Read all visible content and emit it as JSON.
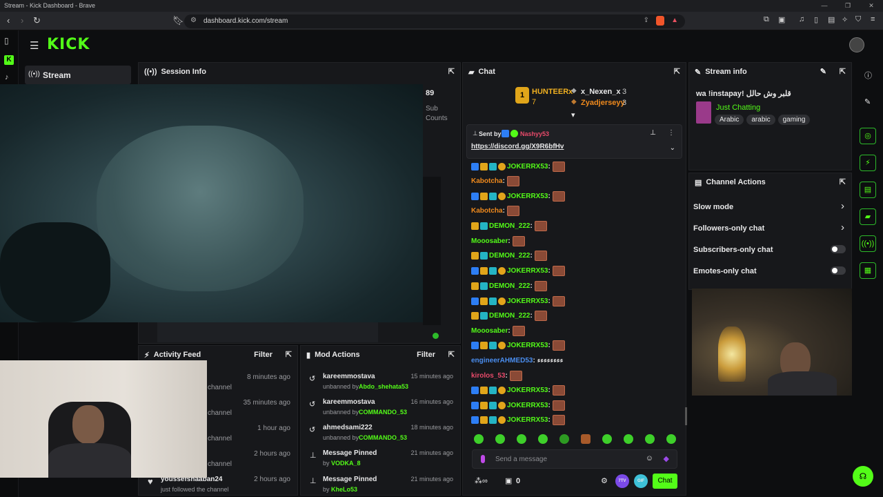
{
  "browser": {
    "window_title": "Stream - Kick Dashboard - Brave",
    "url": "dashboard.kick.com/stream"
  },
  "header": {
    "logo": "KICK"
  },
  "sidebar": {
    "stream_label": "Stream"
  },
  "session_info": {
    "title": "Session Info",
    "stat_value": "89",
    "stat_label_1": "Sub",
    "stat_label_2": "Counts"
  },
  "chat": {
    "title": "Chat",
    "leaderboard": {
      "rank1_name": "HUNTEERx",
      "rank1_count": "7",
      "rank2_name": "x_Nexen_x",
      "rank2_count": "3",
      "rank3_name": "Zyadjerseyy",
      "rank3_count": "3"
    },
    "pinned": {
      "sent_by": "Sent by",
      "user": "Nashyy53",
      "link": "https://discord.gg/X9R6bfHv"
    },
    "messages": [
      {
        "user": "JOKERRX53",
        "color": "green"
      },
      {
        "user": "Kabotcha",
        "color": "orange"
      },
      {
        "user": "JOKERRX53",
        "color": "green"
      },
      {
        "user": "Kabotcha",
        "color": "orange"
      },
      {
        "user": "DEMON_222",
        "color": "green"
      },
      {
        "user": "Mooosaber",
        "color": "green"
      },
      {
        "user": "DEMON_222",
        "color": "green"
      },
      {
        "user": "JOKERRX53",
        "color": "green"
      },
      {
        "user": "DEMON_222",
        "color": "green"
      },
      {
        "user": "JOKERRX53",
        "color": "green"
      },
      {
        "user": "DEMON_222",
        "color": "green"
      },
      {
        "user": "Mooosaber",
        "color": "green"
      },
      {
        "user": "JOKERRX53",
        "color": "green"
      },
      {
        "user": "engineerAHMED53",
        "color": "blue",
        "text": "ءءءءءءءء"
      },
      {
        "user": "kirolos_53",
        "color": "pink"
      },
      {
        "user": "JOKERRX53",
        "color": "green"
      },
      {
        "user": "JOKERRX53",
        "color": "green"
      },
      {
        "user": "JOKERRX53",
        "color": "green"
      }
    ],
    "input_placeholder": "Send a message",
    "viewer_count": "0",
    "send_label": "Chat",
    "btn_7tv": "7TV",
    "btn_gif": "GIF"
  },
  "stream_info": {
    "title": "Stream info",
    "stream_title": "قلبر وش حالل !wa !instapay",
    "category": "Just Chatting",
    "tags": [
      "Arabic",
      "arabic",
      "gaming"
    ]
  },
  "channel_actions": {
    "title": "Channel Actions",
    "items": [
      "Slow mode",
      "Followers-only chat",
      "Subscribers-only chat",
      "Emotes-only chat"
    ]
  },
  "activity_feed": {
    "title": "Activity Feed",
    "filter": "Filter",
    "items": [
      {
        "text": "channel",
        "time": "8 minutes ago"
      },
      {
        "text": "channel",
        "time": "35 minutes ago"
      },
      {
        "text": "channel",
        "time": "1 hour ago"
      },
      {
        "text": "channel",
        "time": "2 hours ago"
      },
      {
        "user": "youssefshaaban24",
        "text": "just followed the channel",
        "time": "2 hours ago"
      }
    ]
  },
  "mod_actions": {
    "title": "Mod Actions",
    "filter": "Filter",
    "items": [
      {
        "title": "kareemmostava",
        "sub": "unbanned by",
        "by": "Abdo_shehata53",
        "time": "15 minutes ago"
      },
      {
        "title": "kareemmostava",
        "sub": "unbanned by",
        "by": "COMMANDO_53",
        "time": "16 minutes ago"
      },
      {
        "title": "ahmedsami222",
        "sub": "unbanned by",
        "by": "COMMANDO_53",
        "time": "18 minutes ago"
      },
      {
        "title": "Message Pinned",
        "sub": "by",
        "by": "VODKA_8",
        "time": "21 minutes ago"
      },
      {
        "title": "Message Pinned",
        "sub": "by",
        "by": "KheLo53",
        "time": "21 minutes ago"
      }
    ]
  }
}
